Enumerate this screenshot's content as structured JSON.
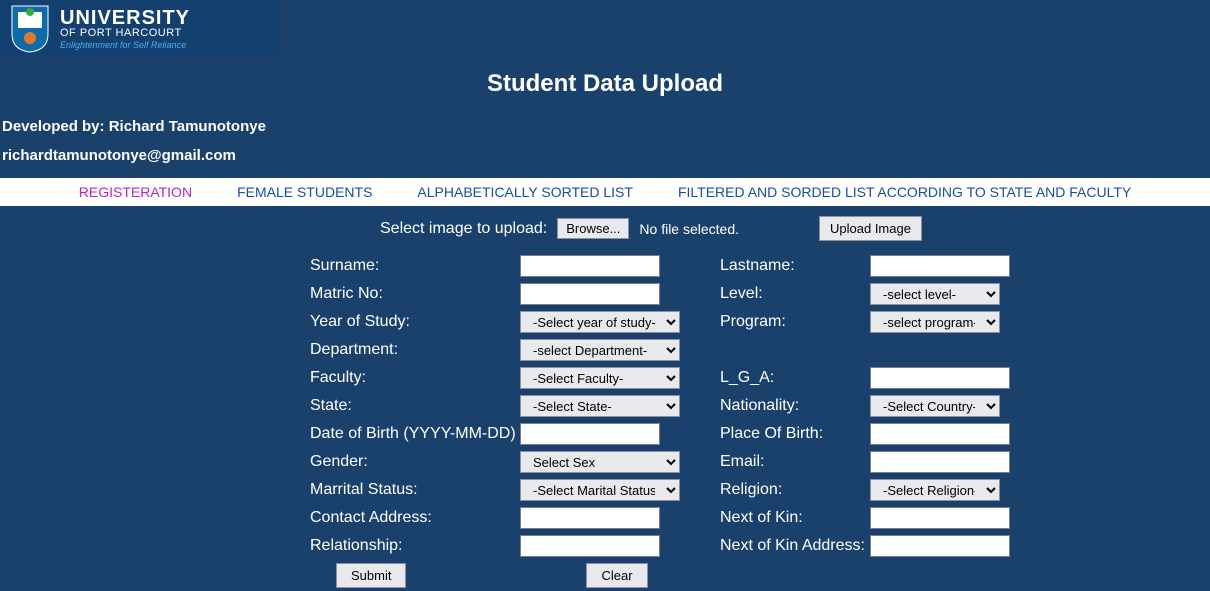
{
  "logo": {
    "uni": "UNIVERSITY",
    "sub": "OF PORT HARCOURT",
    "tag": "Enlightenment for Self Reliance"
  },
  "title": "Student Data Upload",
  "devLine": "Developed by: Richard Tamunotonye",
  "emailLine": "richardtamunotonye@gmail.com",
  "nav": {
    "registration": "REGISTERATION",
    "female": "FEMALE STUDENTS",
    "alpha": "ALPHABETICALLY SORTED LIST",
    "filtered": "FILTERED AND SORDED LIST ACCORDING TO STATE AND FACULTY"
  },
  "upload": {
    "label": "Select image to upload:",
    "browse": "Browse...",
    "nofile": "No file selected.",
    "button": "Upload Image"
  },
  "form": {
    "surname": "Surname:",
    "lastname": "Lastname:",
    "matric": "Matric No:",
    "level": "Level:",
    "levelSel": "-select level-",
    "year": "Year of Study:",
    "yearSel": "-Select year of study-",
    "program": "Program:",
    "programSel": "-select program-",
    "department": "Department:",
    "departmentSel": "-select Department-",
    "faculty": "Faculty:",
    "facultySel": "-Select Faculty-",
    "lga": "L_G_A:",
    "state": "State:",
    "stateSel": "-Select State-",
    "nationality": "Nationality:",
    "nationalitySel": "-Select Country-",
    "dob": "Date of Birth (YYYY-MM-DD)",
    "pob": "Place Of Birth:",
    "gender": "Gender:",
    "genderSel": "Select Sex",
    "email": "Email:",
    "marital": "Marrital Status:",
    "maritalSel": "-Select Marital Status-",
    "religion": "Religion:",
    "religionSel": "-Select Religion-",
    "contact": "Contact Address:",
    "nok": "Next of Kin:",
    "relationship": "Relationship:",
    "nokAddr": "Next of Kin Address:",
    "submit": "Submit",
    "clear": "Clear"
  }
}
